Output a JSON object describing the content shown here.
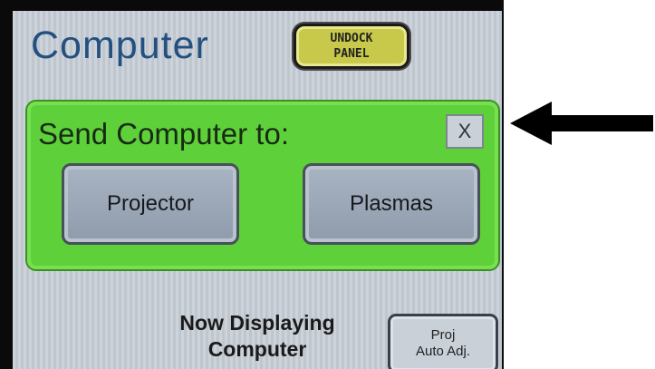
{
  "panel": {
    "title": "Computer",
    "undock_line1": "UNDOCK",
    "undock_line2": "PANEL"
  },
  "popup": {
    "title": "Send Computer to:",
    "close_label": "X",
    "projector_label": "Projector",
    "plasmas_label": "Plasmas"
  },
  "status": {
    "line1": "Now Displaying",
    "line2": "Computer"
  },
  "auto_adjust": {
    "line1": "Proj",
    "line2": "Auto Adj."
  },
  "colors": {
    "popup_green": "#5ed13a",
    "undock_yellow": "#c8c84a",
    "title_blue": "#245080"
  },
  "annotation": {
    "icon": "left-arrow-icon"
  }
}
